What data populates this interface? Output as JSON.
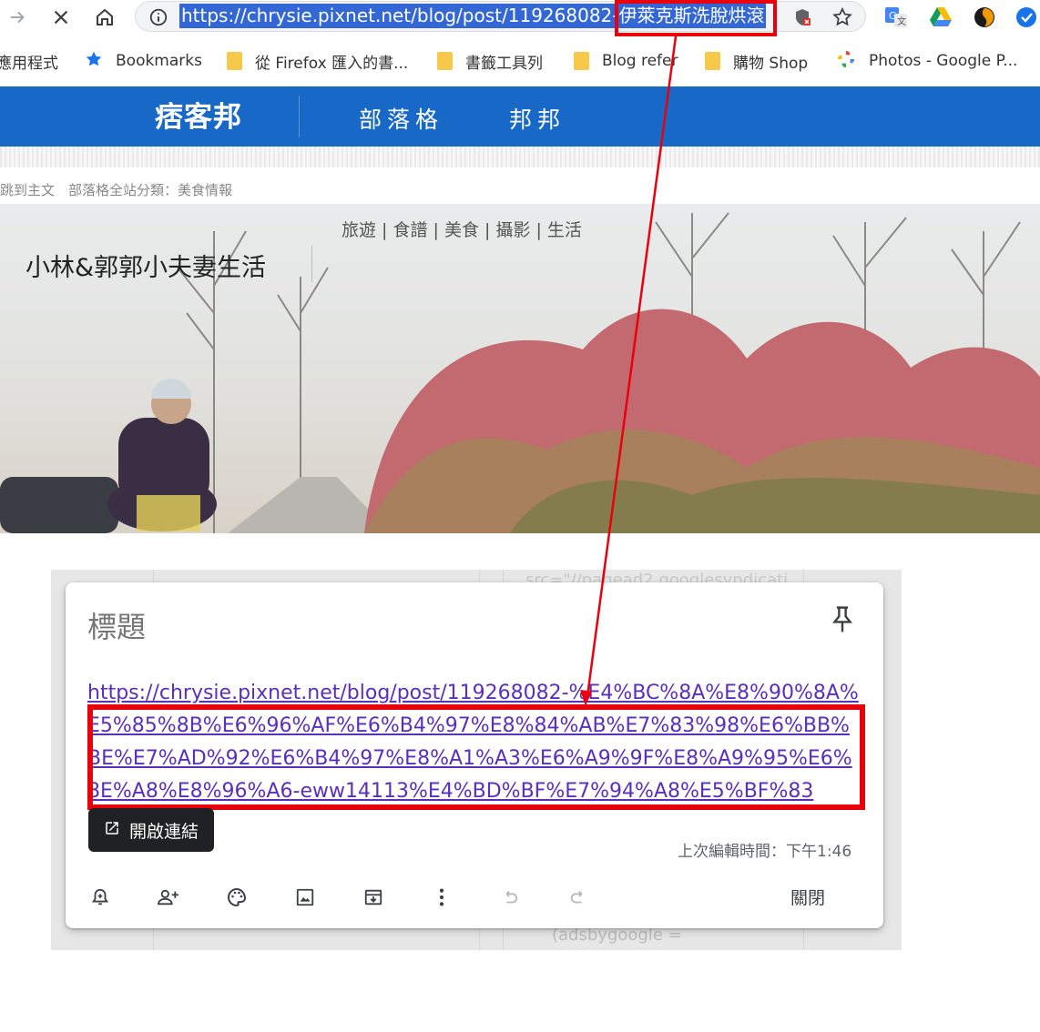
{
  "browser": {
    "url_selected": "https://chrysie.pixnet.net/blog/post/119268082-",
    "url_highlight": "伊萊克斯洗脫烘滾"
  },
  "bookmarks": [
    {
      "label": "應用程式",
      "icon": "apps-icon"
    },
    {
      "label": "Bookmarks",
      "icon": "star-icon"
    },
    {
      "label": "從 Firefox 匯入的書...",
      "icon": "folder-icon"
    },
    {
      "label": "書籤工具列",
      "icon": "folder-icon"
    },
    {
      "label": "Blog refer",
      "icon": "folder-icon"
    },
    {
      "label": "購物 Shop",
      "icon": "folder-icon"
    },
    {
      "label": "Photos - Google P...",
      "icon": "photos-icon"
    }
  ],
  "pixnet": {
    "logo": "痞客邦",
    "nav": [
      "部落格",
      "邦邦"
    ],
    "breadcrumb": "跳到主文　部落格全站分類：美食情報"
  },
  "blog": {
    "nav": "旅遊 | 食譜 | 美食 | 攝影 | 生活",
    "title": "小林&郭郭小夫妻生活"
  },
  "background_code": {
    "top": "src=\"//pagead2.googlesyndicati",
    "bottom": "(adsbygoogle ="
  },
  "note": {
    "title_placeholder": "標題",
    "link_text": "https://chrysie.pixnet.net/blog/post/119268082-%E4%BC%8A%E8%90%8A%E5%85%8B%E6%96%AF%E6%B4%97%E8%84%AB%E7%83%98%E6%BB%BE%E7%AD%92%E6%B4%97%E8%A1%A3%E6%A9%9F%E8%A9%95%E6%8E%A8%E8%96%A6-eww14113%E4%BD%BF%E7%94%A8%E5%BF%83",
    "open_link": "開啟連結",
    "edit_time": "上次編輯時間：下午1:46",
    "close": "關閉",
    "toolbar_icons": [
      "add-alert-icon",
      "collaborator-icon",
      "palette-icon",
      "image-icon",
      "archive-icon",
      "more-icon",
      "undo-icon",
      "redo-icon"
    ]
  },
  "colors": {
    "pixnet_blue": "#1768c7",
    "highlight_red": "#e8000b",
    "link_purple": "#5b2fbd",
    "selection_blue": "#3367d6"
  }
}
